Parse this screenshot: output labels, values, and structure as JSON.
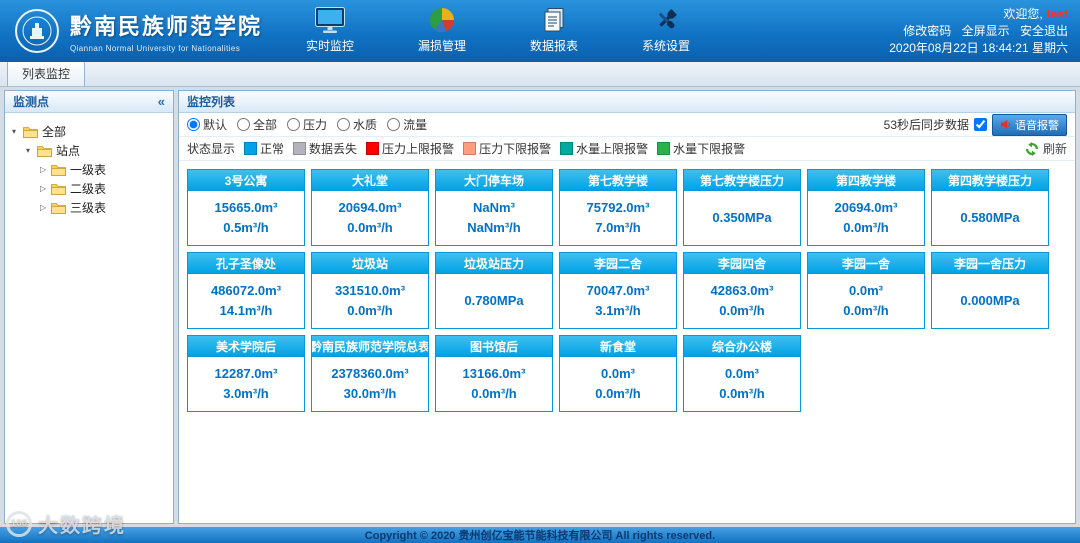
{
  "colors": {
    "header_blue": "#1173c4",
    "card_header": "#00a2e4",
    "card_border": "#0a97d5",
    "value_text": "#0072c8",
    "username_red": "#ff2d2d"
  },
  "icons": {
    "tree_expanded": "▾",
    "tree_collapsed": "▷",
    "panel_collapse": "«"
  },
  "header": {
    "university_cn": "黔南民族师范学院",
    "university_en": "Qiannan Normal University for Nationalities",
    "nav": [
      {
        "label": "实时监控",
        "icon": "monitor-icon"
      },
      {
        "label": "漏损管理",
        "icon": "leakage-pie-icon"
      },
      {
        "label": "数据报表",
        "icon": "data-report-icon"
      },
      {
        "label": "系统设置",
        "icon": "settings-tools-icon"
      }
    ],
    "welcome_prefix": "欢迎您,",
    "username": "test",
    "links": [
      "修改密码",
      "全屏显示",
      "安全退出"
    ],
    "datetime": "2020年08月22日 18:44:21 星期六"
  },
  "tabs": {
    "list_monitor": "列表监控"
  },
  "sidebar": {
    "title": "监测点",
    "tree": {
      "root_label": "全部",
      "site_label": "站点",
      "leaves": [
        {
          "label": "一级表"
        },
        {
          "label": "二级表"
        },
        {
          "label": "三级表"
        }
      ]
    }
  },
  "main": {
    "title": "监控列表",
    "filters": [
      {
        "label": "默认",
        "checked": true
      },
      {
        "label": "全部",
        "checked": false
      },
      {
        "label": "压力",
        "checked": false
      },
      {
        "label": "水质",
        "checked": false
      },
      {
        "label": "流量",
        "checked": false
      }
    ],
    "sync_label": "53秒后同步数据",
    "sync_checked": true,
    "voice_alarm_label": "语音报警",
    "legend_title": "状态显示",
    "legend": [
      {
        "label": "正常",
        "color": "#00a2e8"
      },
      {
        "label": "数据丢失",
        "color": "#b3b3bd"
      },
      {
        "label": "压力上限报警",
        "color": "#fe0000"
      },
      {
        "label": "压力下限报警",
        "color": "#ff9d7e"
      },
      {
        "label": "水量上限报警",
        "color": "#00a99d"
      },
      {
        "label": "水量下限报警",
        "color": "#2bb14c"
      }
    ],
    "refresh_label": "刷新",
    "cards": [
      {
        "title": "3号公寓",
        "value1": "15665.0m³",
        "value2": "0.5m³/h"
      },
      {
        "title": "大礼堂",
        "value1": "20694.0m³",
        "value2": "0.0m³/h"
      },
      {
        "title": "大门停车场",
        "value1": "NaNm³",
        "value2": "NaNm³/h"
      },
      {
        "title": "第七教学楼",
        "value1": "75792.0m³",
        "value2": "7.0m³/h"
      },
      {
        "title": "第七教学楼压力",
        "value1": "0.350MPa",
        "value2": ""
      },
      {
        "title": "第四教学楼",
        "value1": "20694.0m³",
        "value2": "0.0m³/h"
      },
      {
        "title": "第四教学楼压力",
        "value1": "0.580MPa",
        "value2": ""
      },
      {
        "title": "孔子圣像处",
        "value1": "486072.0m³",
        "value2": "14.1m³/h"
      },
      {
        "title": "垃圾站",
        "value1": "331510.0m³",
        "value2": "0.0m³/h"
      },
      {
        "title": "垃圾站压力",
        "value1": "0.780MPa",
        "value2": ""
      },
      {
        "title": "李园二舍",
        "value1": "70047.0m³",
        "value2": "3.1m³/h"
      },
      {
        "title": "李园四舍",
        "value1": "42863.0m³",
        "value2": "0.0m³/h"
      },
      {
        "title": "李园一舍",
        "value1": "0.0m³",
        "value2": "0.0m³/h"
      },
      {
        "title": "李园一舍压力",
        "value1": "0.000MPa",
        "value2": ""
      },
      {
        "title": "美术学院后",
        "value1": "12287.0m³",
        "value2": "3.0m³/h"
      },
      {
        "title": "黔南民族师范学院总表",
        "value1": "2378360.0m³",
        "value2": "30.0m³/h"
      },
      {
        "title": "图书馆后",
        "value1": "13166.0m³",
        "value2": "0.0m³/h"
      },
      {
        "title": "新食堂",
        "value1": "0.0m³",
        "value2": "0.0m³/h"
      },
      {
        "title": "综合办公楼",
        "value1": "0.0m³",
        "value2": "0.0m³/h"
      }
    ]
  },
  "footer": {
    "copyright": "Copyright © 2020 贵州创亿宝能节能科技有限公司 All rights reserved."
  },
  "watermark": {
    "logo_text": "100",
    "text": "大数跨境"
  }
}
